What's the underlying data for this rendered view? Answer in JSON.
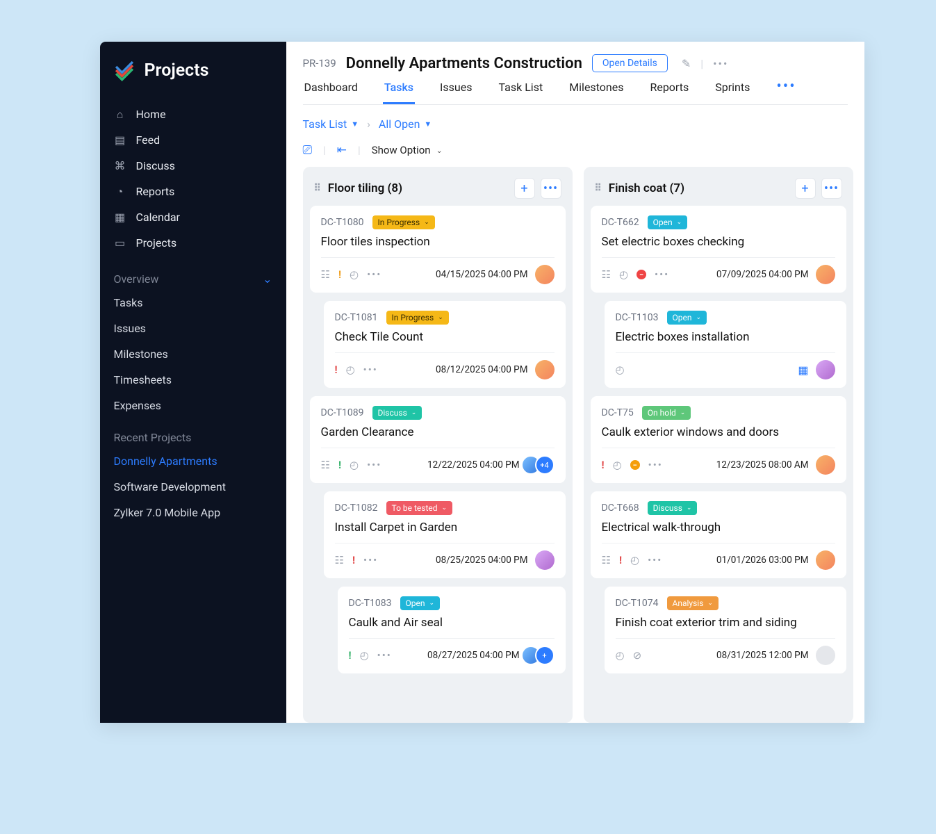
{
  "sidebar": {
    "brand": "Projects",
    "nav": [
      {
        "label": "Home"
      },
      {
        "label": "Feed"
      },
      {
        "label": "Discuss"
      },
      {
        "label": "Reports"
      },
      {
        "label": "Calendar"
      },
      {
        "label": "Projects"
      }
    ],
    "overview_label": "Overview",
    "overview_items": [
      "Tasks",
      "Issues",
      "Milestones",
      "Timesheets",
      "Expenses"
    ],
    "recent_label": "Recent Projects",
    "recent_items": [
      "Donnelly Apartments",
      "Software Development",
      "Zylker 7.0 Mobile App"
    ]
  },
  "header": {
    "code": "PR-139",
    "title": "Donnelly Apartments Construction",
    "open_details": "Open Details",
    "tabs": [
      "Dashboard",
      "Tasks",
      "Issues",
      "Task List",
      "Milestones",
      "Reports",
      "Sprints"
    ]
  },
  "breadcrumb": {
    "a": "Task List",
    "b": "All Open"
  },
  "toolbar": {
    "show": "Show Option"
  },
  "columns": [
    {
      "title": "Floor tiling",
      "count": "(8)",
      "cards": [
        {
          "id": "DC-T1080",
          "status": "In Progress",
          "scls": "b-progress",
          "title": "Floor tiles inspection",
          "due": "04/15/2025 04:00 PM",
          "indent": 0,
          "pri": "y",
          "subtask": true,
          "timer": true,
          "dots": true,
          "av": "avatar"
        },
        {
          "id": "DC-T1081",
          "status": "In Progress",
          "scls": "b-progress",
          "title": "Check Tile Count",
          "due": "08/12/2025 04:00 PM",
          "indent": 1,
          "pri": "r",
          "timer": true,
          "dots": true,
          "av": "avatar"
        },
        {
          "id": "DC-T1089",
          "status": "Discuss",
          "scls": "b-discuss",
          "title": "Garden Clearance",
          "due": "12/22/2025 04:00 PM",
          "indent": 0,
          "pri": "g",
          "subtask": true,
          "timer": true,
          "dots": true,
          "av": "av-b",
          "plus": "+4"
        },
        {
          "id": "DC-T1082",
          "status": "To be tested",
          "scls": "b-tested",
          "title": "Install Carpet in Garden",
          "due": "08/25/2025 04:00 PM",
          "indent": 1,
          "pri": "r",
          "subtask": true,
          "dots": true,
          "av": "av-p"
        },
        {
          "id": "DC-T1083",
          "status": "Open",
          "scls": "b-open",
          "title": "Caulk and Air seal",
          "due": "08/27/2025 04:00 PM",
          "indent": 2,
          "pri": "g",
          "timer": true,
          "dots": true,
          "av": "av-b",
          "plus": "+"
        }
      ]
    },
    {
      "title": "Finish coat",
      "count": "(7)",
      "cards": [
        {
          "id": "DC-T662",
          "status": "Open",
          "scls": "b-open",
          "title": "Set electric boxes checking",
          "due": "07/09/2025 04:00 PM",
          "indent": 0,
          "subtask": true,
          "timer": true,
          "minus": "red",
          "dots": true,
          "av": "avatar"
        },
        {
          "id": "DC-T1103",
          "status": "Open",
          "scls": "b-open",
          "title": "Electric boxes installation",
          "due": "",
          "indent": 1,
          "timer": true,
          "cal": true,
          "av": "av-p"
        },
        {
          "id": "DC-T75",
          "status": "On hold",
          "scls": "b-hold",
          "title": "Caulk exterior windows and doors",
          "due": "12/23/2025 08:00 AM",
          "indent": 0,
          "pri": "r",
          "timer": true,
          "minus": "y",
          "dots": true,
          "av": "avatar"
        },
        {
          "id": "DC-T668",
          "status": "Discuss",
          "scls": "b-discuss",
          "title": "Electrical walk-through",
          "due": "01/01/2026 03:00 PM",
          "indent": 0,
          "pri": "r",
          "subtask": true,
          "timer": true,
          "dots": true,
          "av": "avatar"
        },
        {
          "id": "DC-T1074",
          "status": "Analysis",
          "scls": "b-analysis",
          "title": "Finish coat exterior trim and siding",
          "due": "08/31/2025 12:00 PM",
          "indent": 1,
          "timer": true,
          "tag": true,
          "av": "av-g"
        }
      ]
    }
  ]
}
